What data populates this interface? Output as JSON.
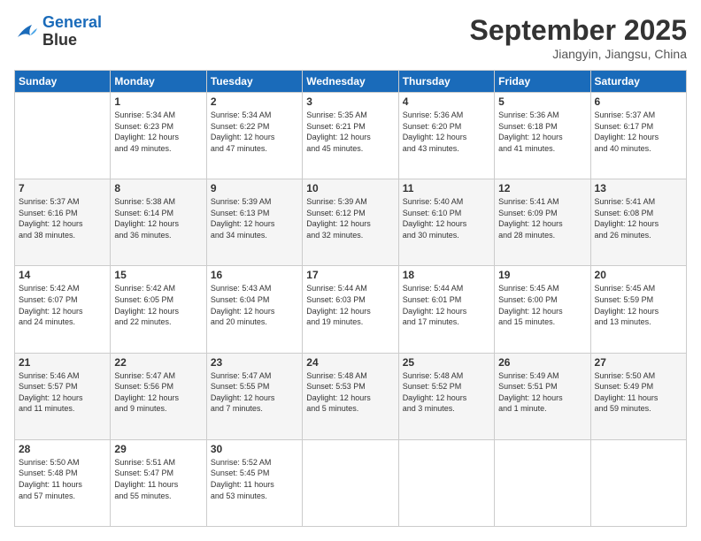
{
  "header": {
    "logo_line1": "General",
    "logo_line2": "Blue",
    "month": "September 2025",
    "location": "Jiangyin, Jiangsu, China"
  },
  "weekdays": [
    "Sunday",
    "Monday",
    "Tuesday",
    "Wednesday",
    "Thursday",
    "Friday",
    "Saturday"
  ],
  "weeks": [
    [
      {
        "day": "",
        "info": ""
      },
      {
        "day": "1",
        "info": "Sunrise: 5:34 AM\nSunset: 6:23 PM\nDaylight: 12 hours\nand 49 minutes."
      },
      {
        "day": "2",
        "info": "Sunrise: 5:34 AM\nSunset: 6:22 PM\nDaylight: 12 hours\nand 47 minutes."
      },
      {
        "day": "3",
        "info": "Sunrise: 5:35 AM\nSunset: 6:21 PM\nDaylight: 12 hours\nand 45 minutes."
      },
      {
        "day": "4",
        "info": "Sunrise: 5:36 AM\nSunset: 6:20 PM\nDaylight: 12 hours\nand 43 minutes."
      },
      {
        "day": "5",
        "info": "Sunrise: 5:36 AM\nSunset: 6:18 PM\nDaylight: 12 hours\nand 41 minutes."
      },
      {
        "day": "6",
        "info": "Sunrise: 5:37 AM\nSunset: 6:17 PM\nDaylight: 12 hours\nand 40 minutes."
      }
    ],
    [
      {
        "day": "7",
        "info": "Sunrise: 5:37 AM\nSunset: 6:16 PM\nDaylight: 12 hours\nand 38 minutes."
      },
      {
        "day": "8",
        "info": "Sunrise: 5:38 AM\nSunset: 6:14 PM\nDaylight: 12 hours\nand 36 minutes."
      },
      {
        "day": "9",
        "info": "Sunrise: 5:39 AM\nSunset: 6:13 PM\nDaylight: 12 hours\nand 34 minutes."
      },
      {
        "day": "10",
        "info": "Sunrise: 5:39 AM\nSunset: 6:12 PM\nDaylight: 12 hours\nand 32 minutes."
      },
      {
        "day": "11",
        "info": "Sunrise: 5:40 AM\nSunset: 6:10 PM\nDaylight: 12 hours\nand 30 minutes."
      },
      {
        "day": "12",
        "info": "Sunrise: 5:41 AM\nSunset: 6:09 PM\nDaylight: 12 hours\nand 28 minutes."
      },
      {
        "day": "13",
        "info": "Sunrise: 5:41 AM\nSunset: 6:08 PM\nDaylight: 12 hours\nand 26 minutes."
      }
    ],
    [
      {
        "day": "14",
        "info": "Sunrise: 5:42 AM\nSunset: 6:07 PM\nDaylight: 12 hours\nand 24 minutes."
      },
      {
        "day": "15",
        "info": "Sunrise: 5:42 AM\nSunset: 6:05 PM\nDaylight: 12 hours\nand 22 minutes."
      },
      {
        "day": "16",
        "info": "Sunrise: 5:43 AM\nSunset: 6:04 PM\nDaylight: 12 hours\nand 20 minutes."
      },
      {
        "day": "17",
        "info": "Sunrise: 5:44 AM\nSunset: 6:03 PM\nDaylight: 12 hours\nand 19 minutes."
      },
      {
        "day": "18",
        "info": "Sunrise: 5:44 AM\nSunset: 6:01 PM\nDaylight: 12 hours\nand 17 minutes."
      },
      {
        "day": "19",
        "info": "Sunrise: 5:45 AM\nSunset: 6:00 PM\nDaylight: 12 hours\nand 15 minutes."
      },
      {
        "day": "20",
        "info": "Sunrise: 5:45 AM\nSunset: 5:59 PM\nDaylight: 12 hours\nand 13 minutes."
      }
    ],
    [
      {
        "day": "21",
        "info": "Sunrise: 5:46 AM\nSunset: 5:57 PM\nDaylight: 12 hours\nand 11 minutes."
      },
      {
        "day": "22",
        "info": "Sunrise: 5:47 AM\nSunset: 5:56 PM\nDaylight: 12 hours\nand 9 minutes."
      },
      {
        "day": "23",
        "info": "Sunrise: 5:47 AM\nSunset: 5:55 PM\nDaylight: 12 hours\nand 7 minutes."
      },
      {
        "day": "24",
        "info": "Sunrise: 5:48 AM\nSunset: 5:53 PM\nDaylight: 12 hours\nand 5 minutes."
      },
      {
        "day": "25",
        "info": "Sunrise: 5:48 AM\nSunset: 5:52 PM\nDaylight: 12 hours\nand 3 minutes."
      },
      {
        "day": "26",
        "info": "Sunrise: 5:49 AM\nSunset: 5:51 PM\nDaylight: 12 hours\nand 1 minute."
      },
      {
        "day": "27",
        "info": "Sunrise: 5:50 AM\nSunset: 5:49 PM\nDaylight: 11 hours\nand 59 minutes."
      }
    ],
    [
      {
        "day": "28",
        "info": "Sunrise: 5:50 AM\nSunset: 5:48 PM\nDaylight: 11 hours\nand 57 minutes."
      },
      {
        "day": "29",
        "info": "Sunrise: 5:51 AM\nSunset: 5:47 PM\nDaylight: 11 hours\nand 55 minutes."
      },
      {
        "day": "30",
        "info": "Sunrise: 5:52 AM\nSunset: 5:45 PM\nDaylight: 11 hours\nand 53 minutes."
      },
      {
        "day": "",
        "info": ""
      },
      {
        "day": "",
        "info": ""
      },
      {
        "day": "",
        "info": ""
      },
      {
        "day": "",
        "info": ""
      }
    ]
  ]
}
